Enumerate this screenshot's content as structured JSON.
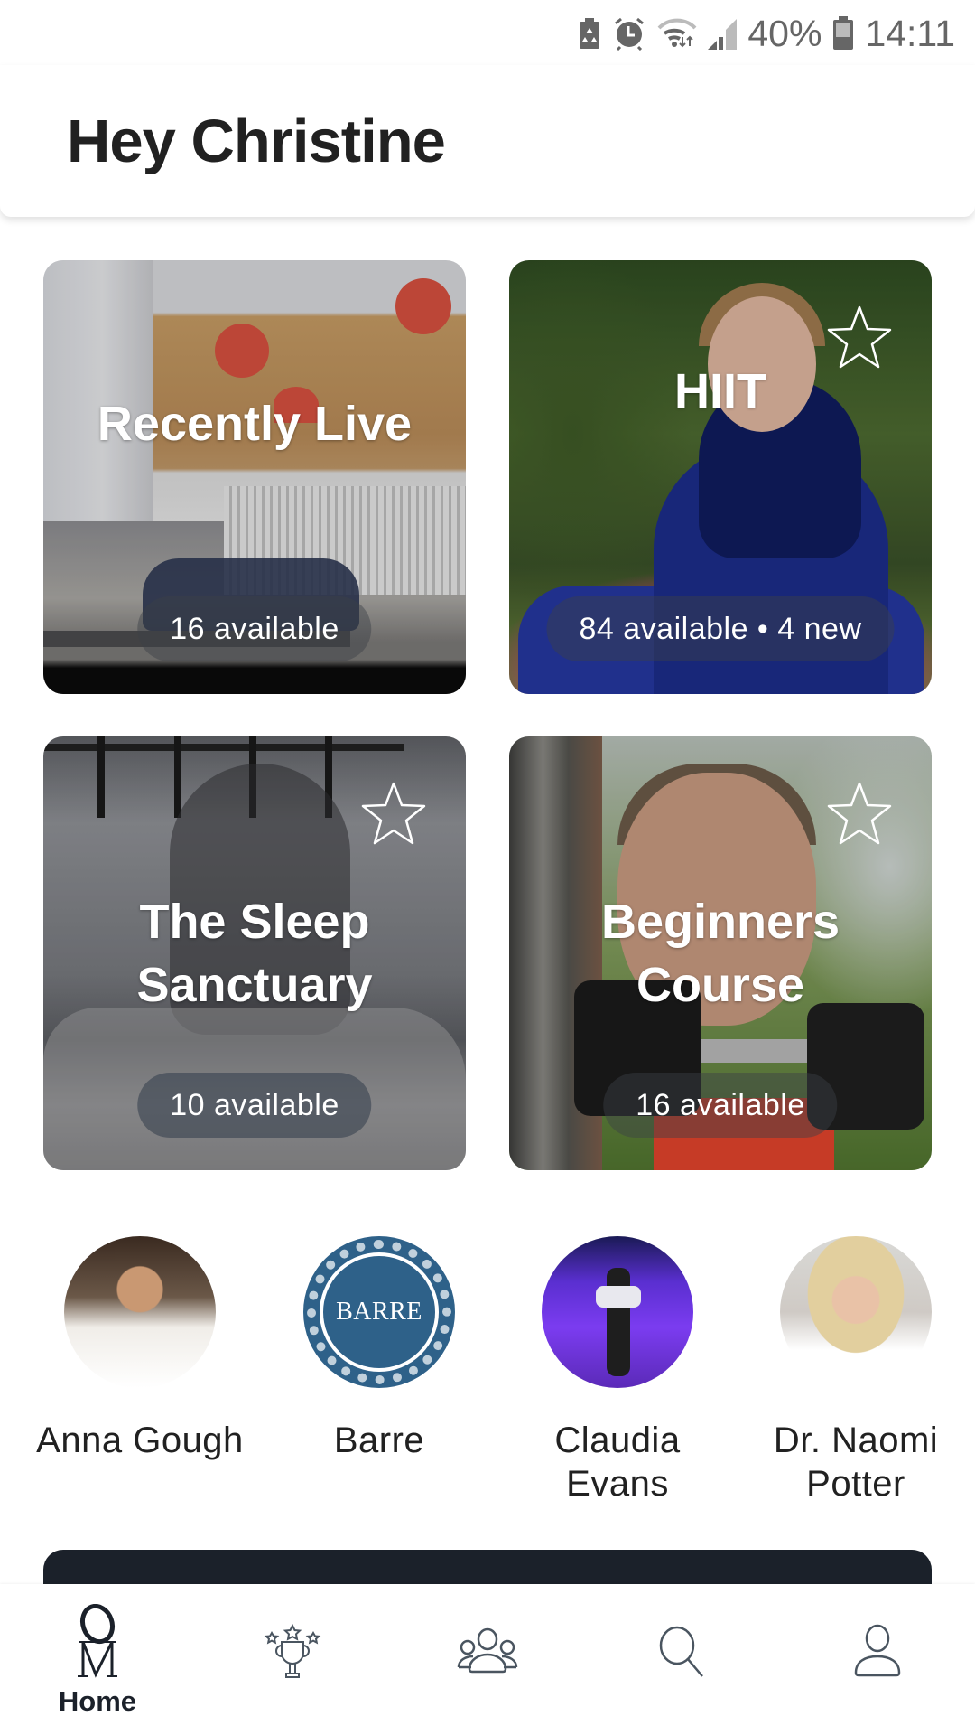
{
  "status_bar": {
    "icons": [
      "battery-saver-icon",
      "alarm-icon",
      "wifi-icon",
      "signal-icon",
      "battery-icon"
    ],
    "battery_percent": "40%",
    "time": "14:11"
  },
  "header": {
    "greeting": "Hey Christine"
  },
  "categories": [
    {
      "title": "Recently Live",
      "availability": "16 available",
      "favorite": false,
      "show_star": false
    },
    {
      "title": "HIIT",
      "availability": "84 available • 4 new",
      "favorite": false,
      "show_star": true
    },
    {
      "title": "The Sleep Sanctuary",
      "availability": "10 available",
      "favorite": false,
      "show_star": true
    },
    {
      "title": "Beginners Course",
      "availability": "16 available",
      "favorite": false,
      "show_star": true
    }
  ],
  "instructors": [
    {
      "name": "Anna Gough"
    },
    {
      "name": "Barre",
      "badge_text": "BARRE"
    },
    {
      "name": "Claudia Evans"
    },
    {
      "name": "Dr. Naomi Potter"
    }
  ],
  "bottom_nav": {
    "items": [
      {
        "id": "home",
        "label": "Home",
        "icon": "om-logo-icon",
        "active": true
      },
      {
        "id": "challenges",
        "label": "",
        "icon": "trophy-icon",
        "active": false
      },
      {
        "id": "community",
        "label": "",
        "icon": "group-icon",
        "active": false
      },
      {
        "id": "search",
        "label": "",
        "icon": "search-icon",
        "active": false
      },
      {
        "id": "profile",
        "label": "",
        "icon": "profile-icon",
        "active": false
      }
    ]
  },
  "colors": {
    "text_primary": "#212121",
    "dark_navy": "#1b212a",
    "barre_blue": "#2e6189",
    "status_gray": "#666666",
    "nav_icon": "#4a5560"
  }
}
